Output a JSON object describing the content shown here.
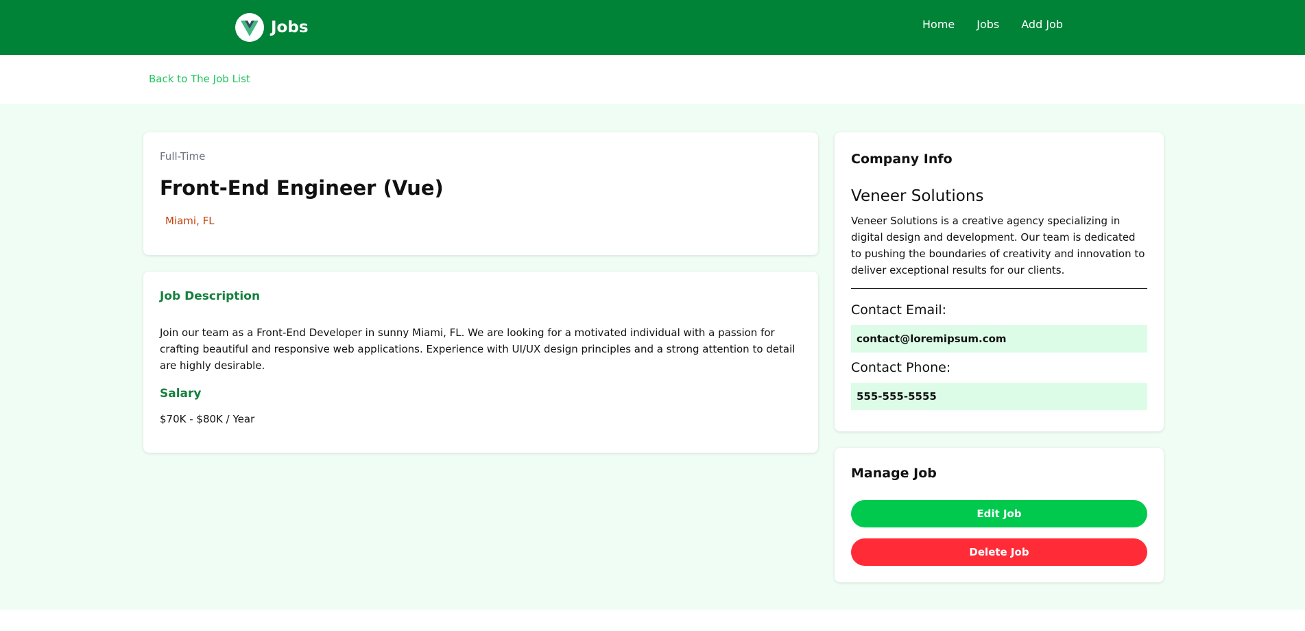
{
  "nav": {
    "brand": "Jobs",
    "links": [
      "Home",
      "Jobs",
      "Add Job"
    ]
  },
  "back_link": "Back to The Job List",
  "job": {
    "type": "Full-Time",
    "title": "Front-End Engineer (Vue)",
    "location": "Miami, FL",
    "description_heading": "Job Description",
    "description": "Join our team as a Front-End Developer in sunny Miami, FL. We are looking for a motivated individual with a passion for crafting beautiful and responsive web applications. Experience with UI/UX design principles and a strong attention to detail are highly desirable.",
    "salary_heading": "Salary",
    "salary": "$70K - $80K / Year"
  },
  "company": {
    "heading": "Company Info",
    "name": "Veneer Solutions",
    "description": "Veneer Solutions is a creative agency specializing in digital design and development. Our team is dedicated to pushing the boundaries of creativity and innovation to deliver exceptional results for our clients.",
    "email_label": "Contact Email:",
    "email": "contact@loremipsum.com",
    "phone_label": "Contact Phone:",
    "phone": "555-555-5555"
  },
  "manage": {
    "heading": "Manage Job",
    "edit_label": "Edit Job",
    "delete_label": "Delete Job"
  },
  "colors": {
    "navbar": "#008337",
    "accent_green": "#22c55e",
    "page_bg": "#f0fdf4",
    "location": "#c2410c",
    "edit_button": "#00c94e",
    "delete_button": "#ff2b37"
  },
  "icons": {
    "logo": "vue-logo-icon",
    "location": "map-marker-icon"
  }
}
